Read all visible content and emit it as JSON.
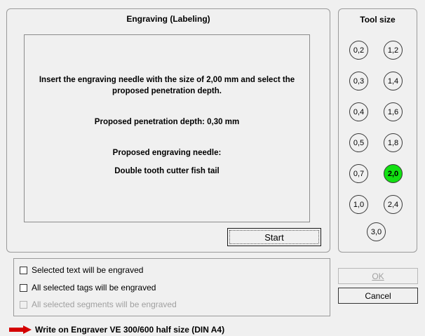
{
  "engraving": {
    "title": "Engraving (Labeling)",
    "instruction_line1": "Insert the engraving needle with the size of 2,00 mm and select the",
    "instruction_line2": "proposed penetration depth.",
    "penetration": "Proposed penetration depth: 0,30 mm",
    "needle_heading": "Proposed engraving needle:",
    "needle_name": "Double tooth cutter fish tail",
    "start_label": "Start"
  },
  "tool_size": {
    "title": "Tool size",
    "sizes": [
      "0,2",
      "1,2",
      "0,3",
      "1,4",
      "0,4",
      "1,6",
      "0,5",
      "1,8",
      "0,7",
      "2,0",
      "1,0",
      "2,4",
      "3,0"
    ],
    "selected": "2,0",
    "selected_color": "#12e012"
  },
  "options": [
    {
      "label": "Selected text will be engraved",
      "checked": false,
      "enabled": true
    },
    {
      "label": "All selected tags will be engraved",
      "checked": false,
      "enabled": true
    },
    {
      "label": "All selected segments will be engraved",
      "checked": false,
      "enabled": false
    }
  ],
  "buttons": {
    "ok": "OK",
    "cancel": "Cancel"
  },
  "status": {
    "text": "Write on Engraver VE 300/600 half size (DIN A4)",
    "arrow_color": "#d40000",
    "arrow_icon": "right-arrow-icon"
  }
}
